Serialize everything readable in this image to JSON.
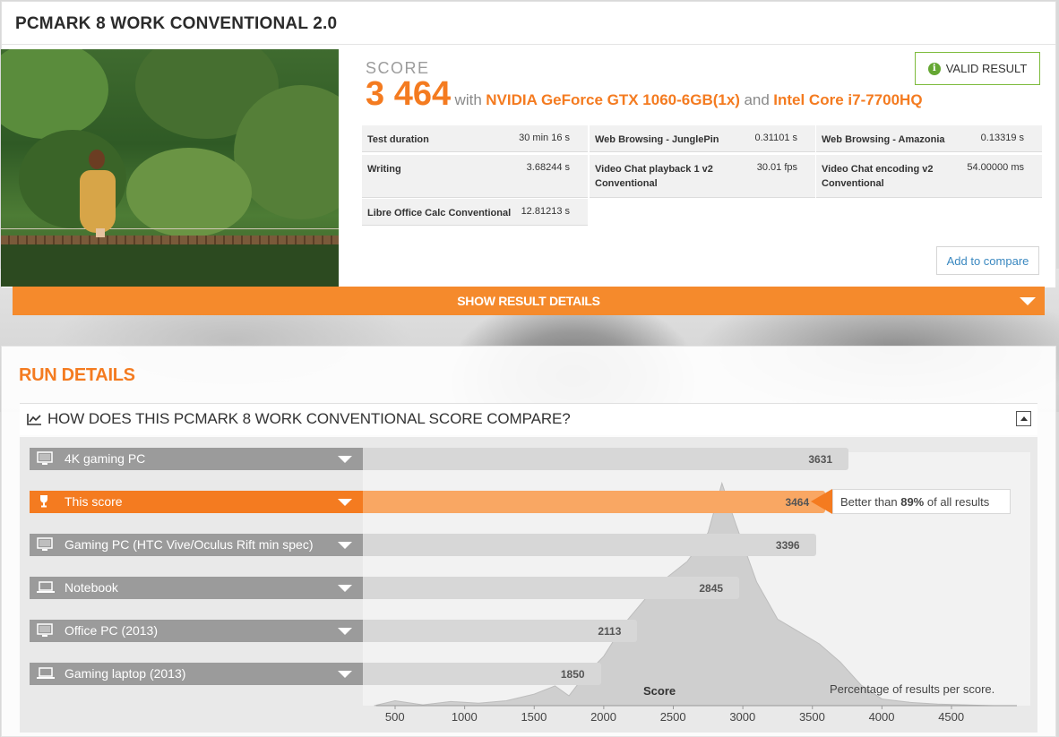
{
  "result": {
    "title": "PCMARK 8 WORK CONVENTIONAL 2.0",
    "score_label": "SCORE",
    "score_value": "3 464",
    "with_text": "with",
    "gpu": "NVIDIA GeForce GTX 1060-6GB(1x)",
    "and_text": "and",
    "cpu": "Intel Core i7-7700HQ",
    "valid_badge": "VALID RESULT",
    "valid_icon": "info-icon",
    "add_to_compare": "Add to compare",
    "metrics": [
      {
        "name": "Test duration",
        "value": "30 min 16 s"
      },
      {
        "name": "Web Browsing - JunglePin",
        "value": "0.31101 s"
      },
      {
        "name": "Web Browsing - Amazonia",
        "value": "0.13319 s"
      },
      {
        "name": "Writing",
        "value": "3.68244 s"
      },
      {
        "name": "Video Chat playback 1 v2 Conventional",
        "value": "30.01 fps"
      },
      {
        "name": "Video Chat encoding v2 Conventional",
        "value": "54.00000 ms"
      },
      {
        "name": "Libre Office Calc Conventional",
        "value": "12.81213 s"
      }
    ]
  },
  "details_bar": {
    "label": "SHOW RESULT DETAILS"
  },
  "run_details": {
    "title": "RUN DETAILS",
    "compare_title": "HOW DOES THIS PCMARK 8 WORK CONVENTIONAL SCORE COMPARE?",
    "better_prefix": "Better than ",
    "better_pct": "89%",
    "better_suffix": " of all results",
    "axis_title": "Score",
    "axis_note": "Percentage of results per score."
  },
  "chart_data": {
    "type": "bar",
    "orientation": "horizontal",
    "categories": [
      "4K gaming PC",
      "This score",
      "Gaming PC (HTC Vive/Oculus Rift min spec)",
      "Notebook",
      "Office PC (2013)",
      "Gaming laptop (2013)"
    ],
    "values": [
      3631,
      3464,
      3396,
      2845,
      2113,
      1850
    ],
    "highlight_index": 1,
    "category_icons": [
      "desktop-icon",
      "trophy-icon",
      "desktop-icon",
      "laptop-icon",
      "desktop-icon",
      "laptop-icon"
    ],
    "x_ticks": [
      500,
      1000,
      1500,
      2000,
      2500,
      3000,
      3500,
      4000,
      4500
    ],
    "xlim": [
      350,
      4800
    ],
    "xlabel": "Score",
    "distribution": {
      "x": [
        350,
        500,
        700,
        900,
        1100,
        1300,
        1500,
        1650,
        1750,
        1850,
        2000,
        2150,
        2300,
        2450,
        2600,
        2750,
        2850,
        2950,
        3100,
        3250,
        3400,
        3550,
        3700,
        3850,
        4000,
        4200,
        4400,
        4600,
        4800
      ],
      "y": [
        0,
        0.6,
        0.1,
        0.5,
        0.3,
        0.6,
        1.4,
        2.4,
        1.2,
        3.4,
        6,
        10,
        13,
        15.5,
        17.5,
        21,
        27,
        22,
        15,
        10.5,
        9,
        7.5,
        5.3,
        2.5,
        0.8,
        0.4,
        0.2,
        0.1,
        0
      ]
    },
    "colors": {
      "highlight": "#f47b20",
      "bar": "#d7d7d7",
      "label_bg": "#9b9b9b",
      "distribution": "#cfcfcf"
    }
  }
}
